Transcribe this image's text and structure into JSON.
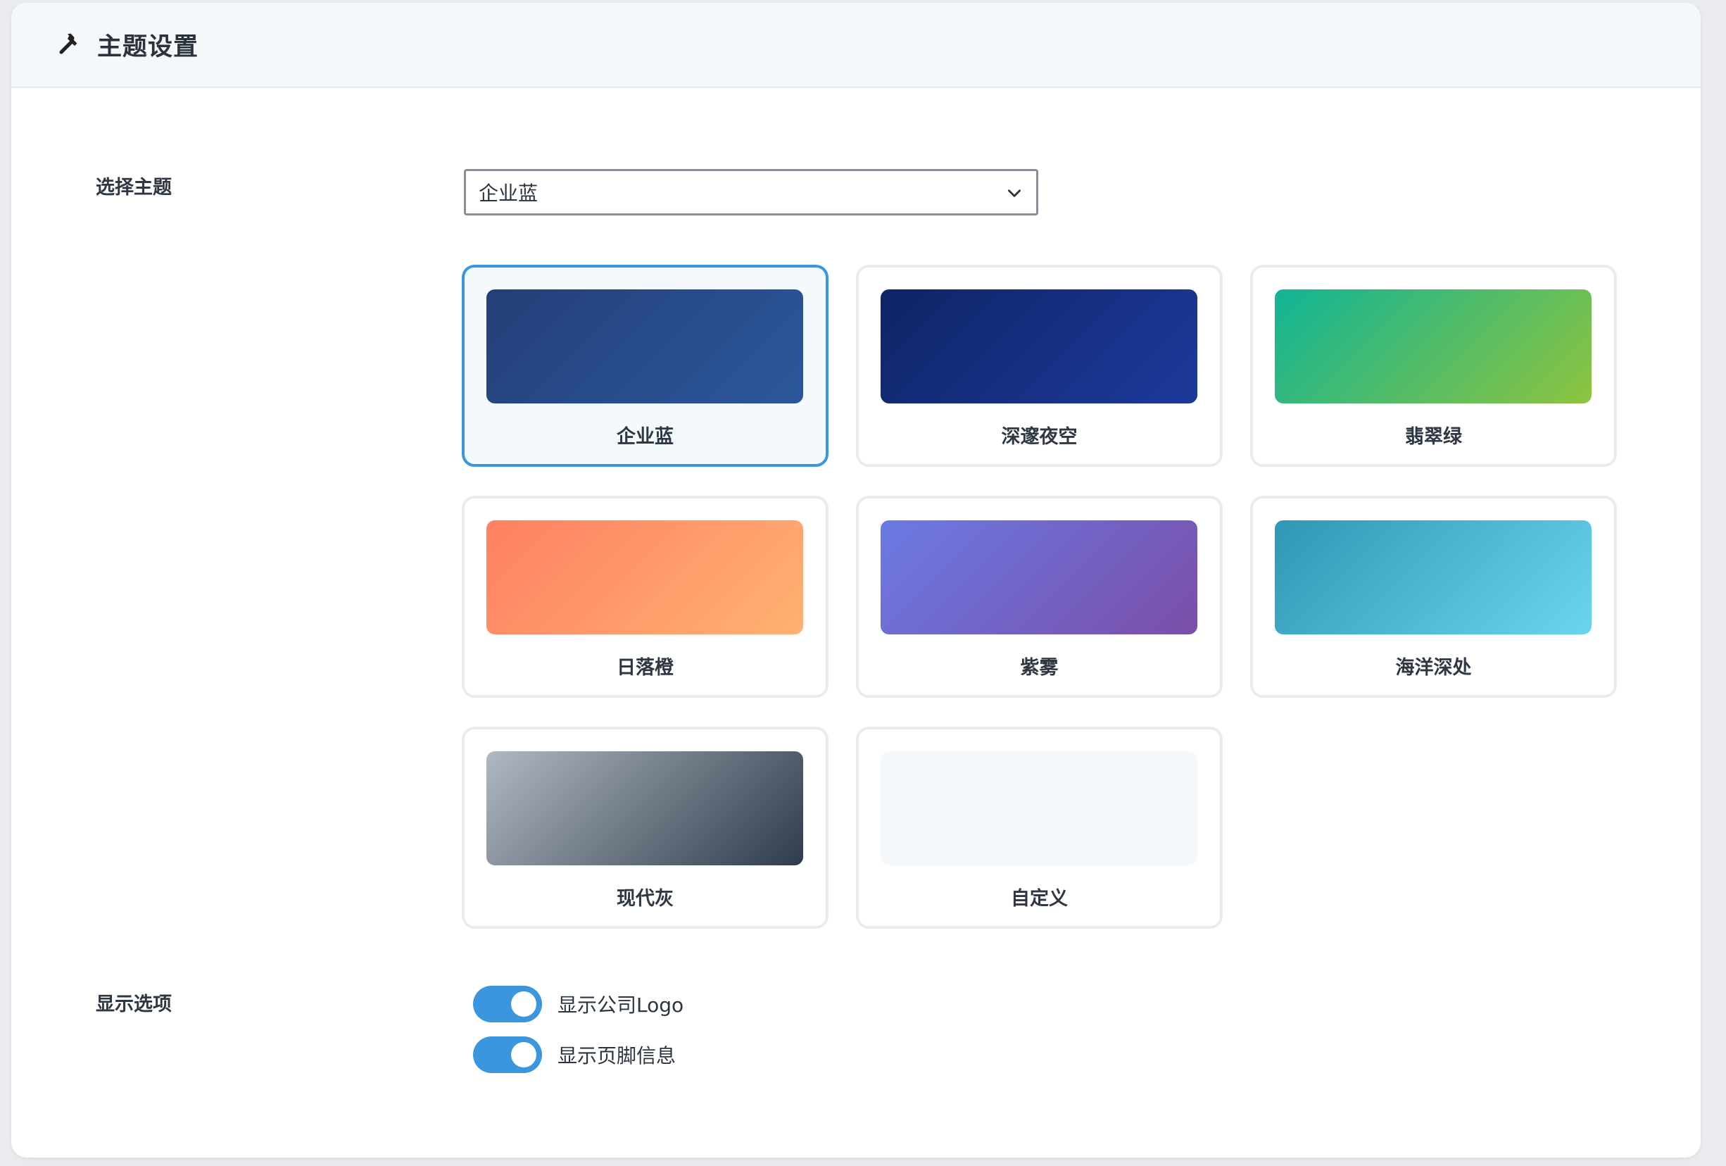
{
  "header": {
    "title": "主题设置",
    "icon": "hammer-icon"
  },
  "theme_select": {
    "label": "选择主题",
    "selected": "企业蓝"
  },
  "themes": [
    {
      "name": "企业蓝",
      "selected": true,
      "from": "#243f78",
      "to": "#2b579c"
    },
    {
      "name": "深邃夜空",
      "selected": false,
      "from": "#0f2466",
      "to": "#1c3a9c"
    },
    {
      "name": "翡翠绿",
      "selected": false,
      "from": "#11b496",
      "to": "#8ec43e"
    },
    {
      "name": "日落橙",
      "selected": false,
      "from": "#ff8061",
      "to": "#ffb273"
    },
    {
      "name": "紫雾",
      "selected": false,
      "from": "#6b7ae4",
      "to": "#7a4ea8"
    },
    {
      "name": "海洋深处",
      "selected": false,
      "from": "#2e97b4",
      "to": "#6bd5ee"
    },
    {
      "name": "现代灰",
      "selected": false,
      "from": "#b0b8c1",
      "to": "#2f3c4c"
    },
    {
      "name": "自定义",
      "selected": false,
      "from": "#f5f8fa",
      "to": "#f5f8fa"
    }
  ],
  "display_options": {
    "label": "显示选项",
    "items": [
      {
        "label": "显示公司Logo",
        "on": true
      },
      {
        "label": "显示页脚信息",
        "on": true
      }
    ]
  },
  "colors": {
    "accent": "#3a96dd",
    "card_border": "#e8ecf1"
  }
}
